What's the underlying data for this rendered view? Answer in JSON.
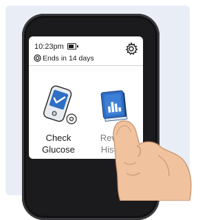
{
  "status_bar": {
    "time": "10:23pm",
    "battery_level": 0.8,
    "sensor_text": "Ends in 14 days"
  },
  "tiles": [
    {
      "label_line1": "Check",
      "label_line2": "Glucose"
    },
    {
      "label_line1": "Review",
      "label_line2": "History"
    }
  ],
  "icons": {
    "settings": "gear-icon",
    "sensor": "sensor-icon",
    "alarm": "bell-icon",
    "battery": "battery-icon"
  },
  "colors": {
    "panel_background": "#e9eef6",
    "device_body": "#1b1b1d",
    "icon_blue": "#2f6fc4",
    "skin": "#f0c29e"
  }
}
